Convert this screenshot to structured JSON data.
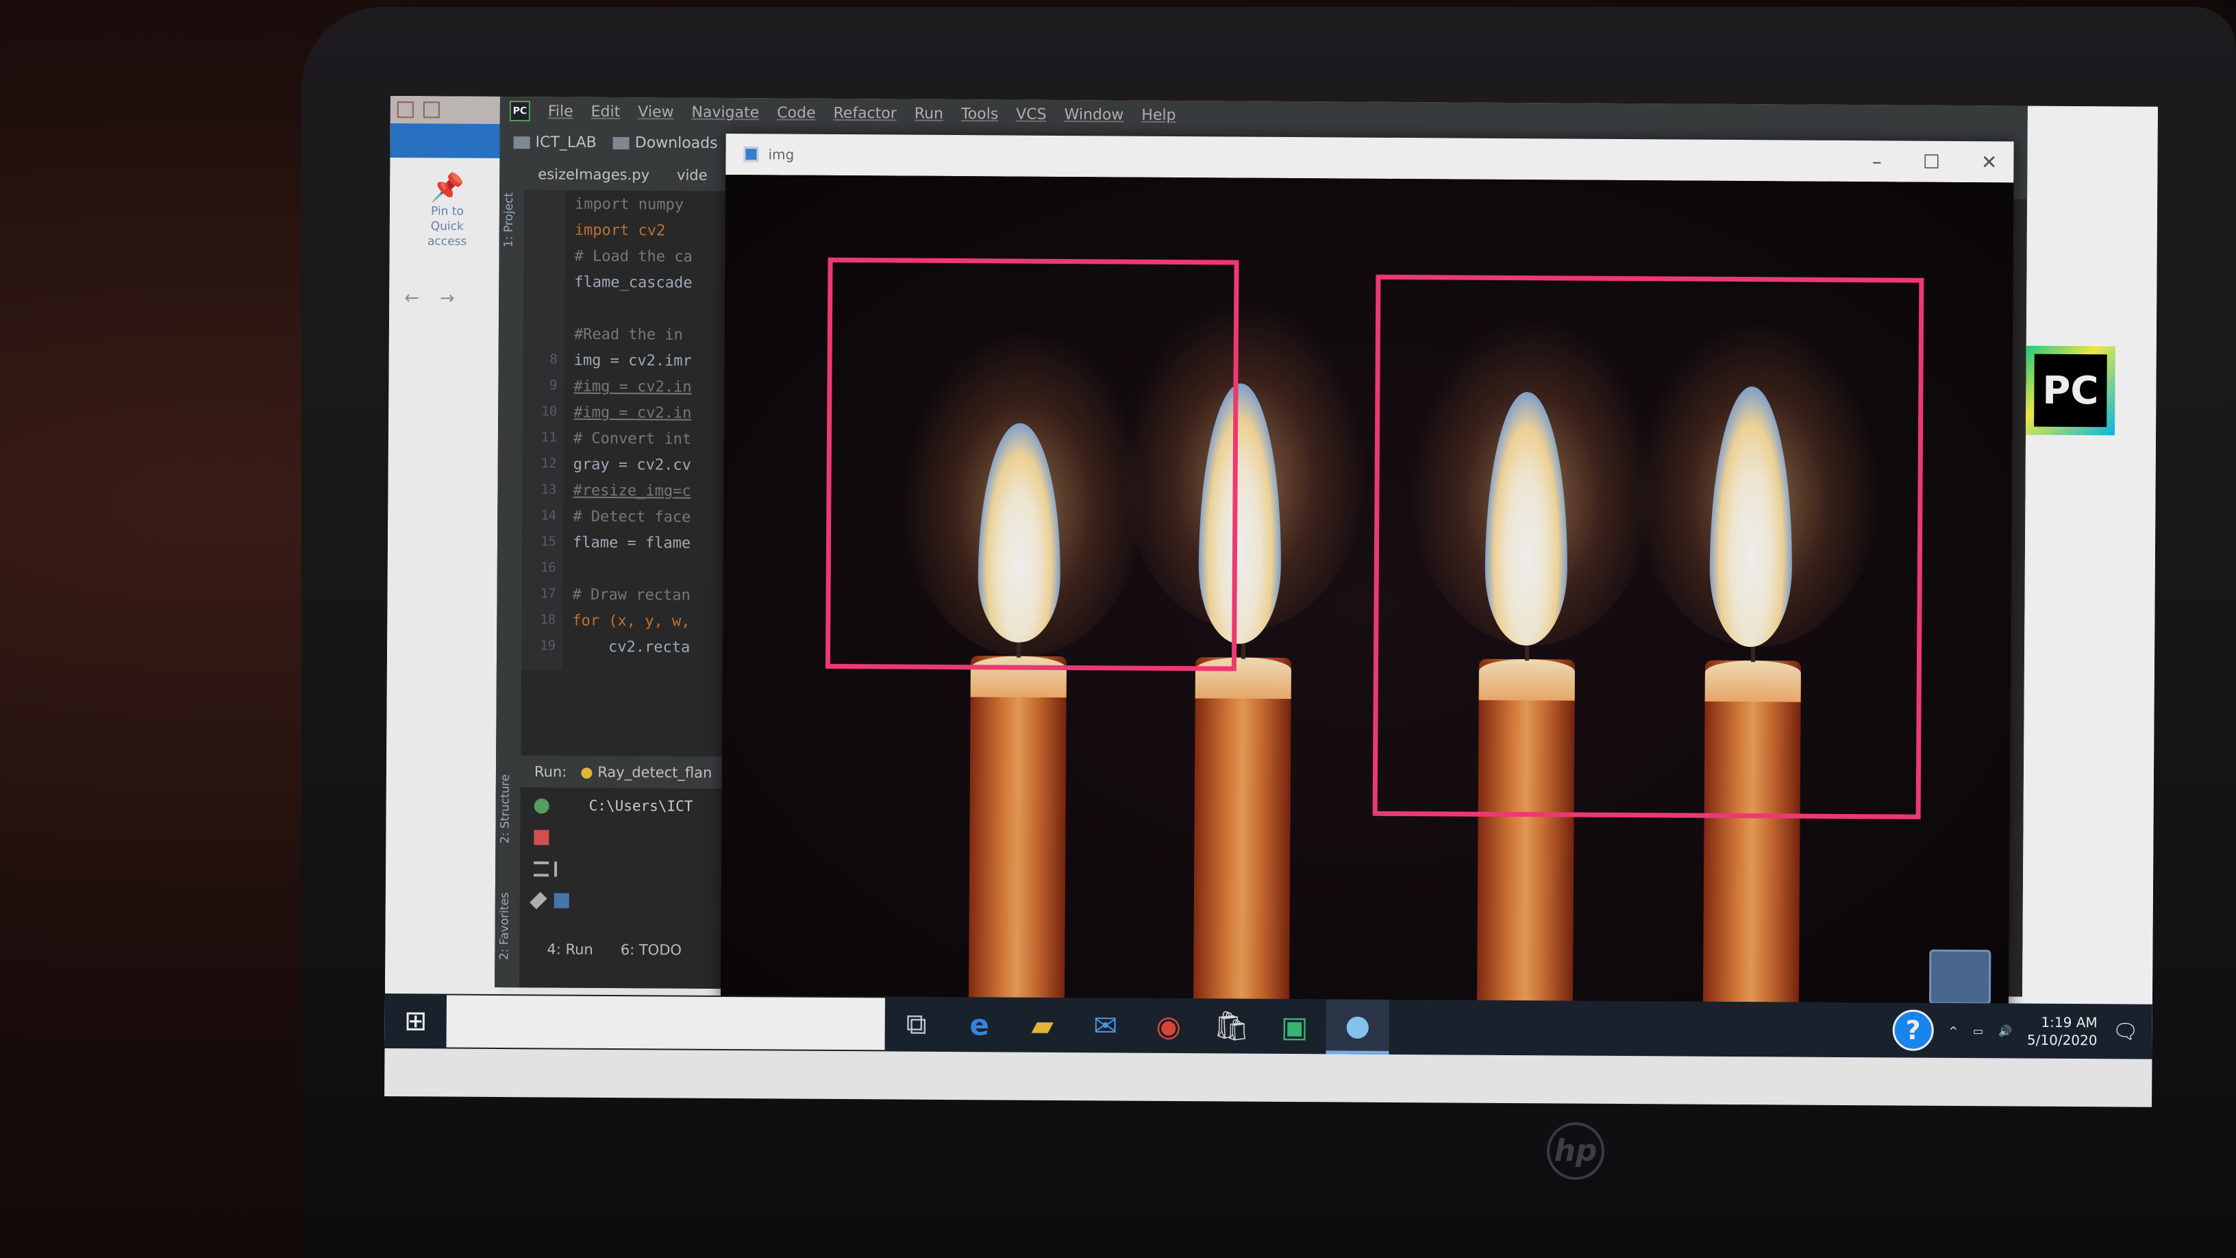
{
  "explorer": {
    "pin_label": "Pin to Quick access"
  },
  "pycharm": {
    "menu": [
      "File",
      "Edit",
      "View",
      "Navigate",
      "Code",
      "Refactor",
      "Run",
      "Tools",
      "VCS",
      "Window",
      "Help"
    ],
    "breadcrumb": [
      "ICT_LAB",
      "Downloads"
    ],
    "tabs": [
      "esizeImages.py",
      "vide"
    ],
    "side_labels": {
      "project": "1: Project",
      "structure": "2: Structure",
      "favorites": "2: Favorites"
    },
    "line_numbers": [
      "8",
      "9",
      "10",
      "11",
      "12",
      "13",
      "14",
      "15",
      "16",
      "17",
      "18",
      "19"
    ],
    "code_lines": [
      "import numpy",
      "import cv2",
      "# Load the ca",
      "flame_cascade",
      "",
      "#Read the in",
      "img = cv2.imr",
      "#img = cv2.in",
      "#img = cv2.in",
      "# Convert int",
      "gray = cv2.cv",
      "#resize_img=c",
      "# Detect face",
      "flame = flame",
      "",
      "# Draw rectan",
      "for (x, y, w,",
      "    cv2.recta"
    ],
    "run_label": "Run:",
    "run_config": "Ray_detect_flan",
    "run_output": "C:\\Users\\ICT",
    "bottom_tabs": [
      "4: Run",
      "6: TODO"
    ]
  },
  "image_window": {
    "title": "img"
  },
  "taskbar": {
    "time": "1:19 AM",
    "date": "5/10/2020"
  },
  "brand": {
    "laptop_logo": "hp",
    "pycharm_badge": "PC"
  },
  "colors": {
    "detection_box": "#ff3d7a",
    "taskbar": "#1b2330",
    "ide_background": "#2b2b2b"
  },
  "icons": [
    "pin-icon",
    "windows-start-icon",
    "task-view-icon",
    "edge-icon",
    "file-explorer-icon",
    "mail-icon",
    "chrome-icon",
    "store-icon",
    "paint-icon",
    "python-icon",
    "help-icon",
    "chevron-up-icon",
    "network-icon",
    "volume-icon",
    "notification-icon"
  ]
}
